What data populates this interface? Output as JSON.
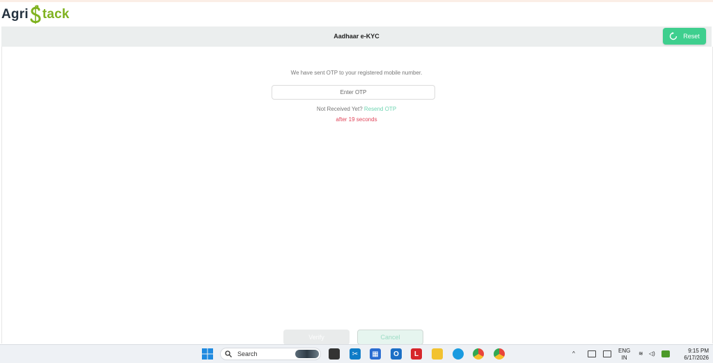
{
  "brand": {
    "part1": "Agri",
    "part2": "tack",
    "logo_icon": "dollar-s-icon"
  },
  "kyc": {
    "title": "Aadhaar e-KYC",
    "reset_label": "Reset"
  },
  "otp": {
    "message": "We have sent OTP to your registered mobile number.",
    "placeholder": "Enter OTP",
    "not_received": "Not Received Yet?",
    "resend_label": "Resend OTP",
    "countdown": "after 19 seconds"
  },
  "actions": {
    "verify_label": "Verify",
    "cancel_label": "Cancel"
  },
  "taskbar": {
    "search_label": "Search",
    "apps": [
      "windows-start-icon",
      "file-explorer-icon",
      "snip-icon",
      "store-icon",
      "outlook-icon",
      "l-app-icon",
      "folder-icon",
      "edge-icon",
      "chrome-icon",
      "chrome-alt-icon"
    ],
    "lang_1": "ENG",
    "lang_2": "IN",
    "time": "9:15 PM",
    "date": "6/17/2026"
  },
  "colors": {
    "accent": "#3ecf8e",
    "resend": "#6fd5b2",
    "countdown": "#e0455a",
    "brand_green": "#7fb21f",
    "brand_dark": "#24323f"
  }
}
